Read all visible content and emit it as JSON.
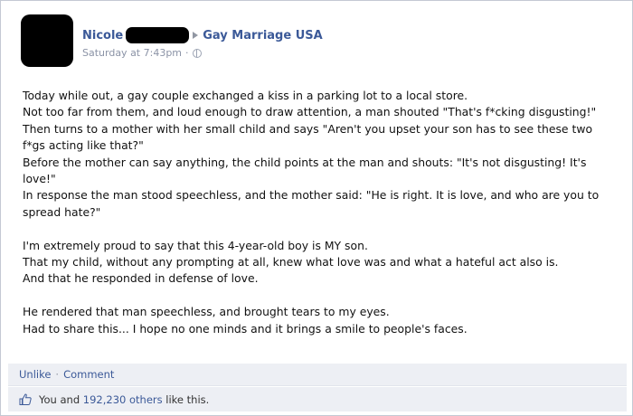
{
  "post": {
    "author_name": "Nicole",
    "page_name": "Gay Marriage USA",
    "timestamp": "Saturday at 7:43pm",
    "meta_separator": "·",
    "privacy_icon": "globe-icon",
    "body_lines": [
      "Today while out, a gay couple exchanged a kiss in a parking lot to a local store.",
      "Not too far from them, and loud enough to draw attention, a man shouted \"That's f*cking disgusting!\"",
      "Then turns to a mother with her small child and says \"Aren't you upset your son has to see these two f*gs acting like that?\"",
      "Before the mother can say anything, the child points at the man and shouts: \"It's not disgusting! It's love!\"",
      "In response the man stood speechless, and the mother said: \"He is right. It is love, and who are you to spread hate?\"",
      "I'm extremely proud to say that this 4-year-old boy is MY son.",
      "That my child, without any prompting at all, knew what love was and what a hateful act also is.",
      "And that he responded in defense of love.",
      "He rendered that man speechless, and brought tears to my eyes.",
      "Had to share this... I hope no one minds and it brings a smile to people's faces."
    ]
  },
  "actions": {
    "unlike_label": "Unlike",
    "separator": "·",
    "comment_label": "Comment"
  },
  "likes": {
    "thumb_icon": "thumbs-up-icon",
    "prefix": "You and",
    "others_link": "192,230 others",
    "suffix": "like this."
  },
  "colors": {
    "link_blue": "#3b5998",
    "bar_bg": "#edeff4"
  }
}
